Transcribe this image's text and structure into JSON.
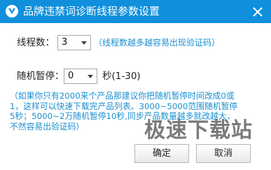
{
  "window": {
    "title": "品牌违禁词诊断线程参数设置",
    "icon": "app-logo-icon",
    "title_bar_color": "#0f8fdc"
  },
  "thread_count": {
    "label": "线程数：",
    "value": "3",
    "hint": "（线程数越多越容易出现验证码）"
  },
  "random_pause": {
    "label": "随机暂停：",
    "value": "0",
    "unit": "秒(1-30)"
  },
  "note": {
    "lines": [
      "（如果你只有2000来个产品那建议你把随机暂停时间改成0或",
      "1，这样可以快速下载完产品列表。3000~5000范围随机暂停",
      "5秒；5000~2万随机暂停10秒,同步产品数量越多就改越大，",
      "不然容易出验证码）"
    ],
    "color": "#1a8fcf"
  },
  "buttons": {
    "ok": "确定",
    "cancel": "取消"
  },
  "watermark": {
    "text": "极速下载站"
  }
}
